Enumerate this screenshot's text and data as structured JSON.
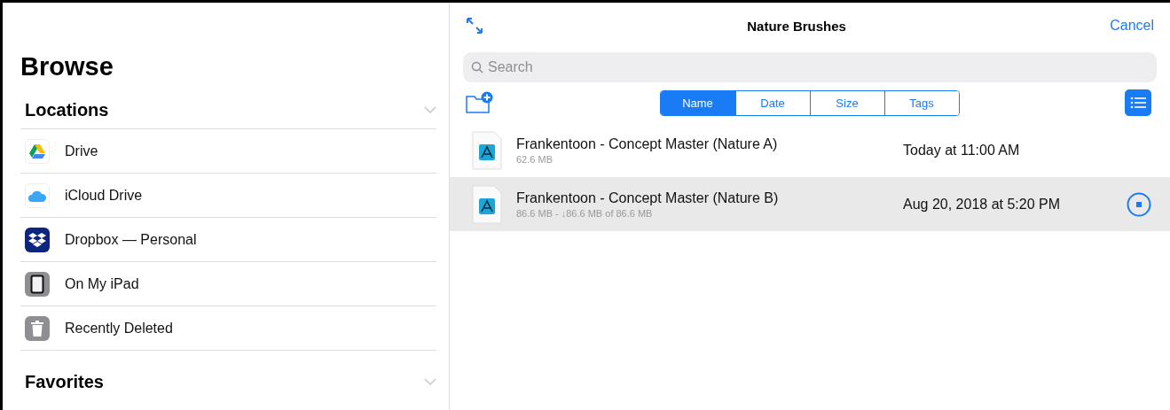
{
  "sidebar": {
    "title": "Browse",
    "sections": [
      {
        "title": "Locations",
        "items": [
          {
            "label": "Drive",
            "kind": "drive"
          },
          {
            "label": "iCloud Drive",
            "kind": "icloud"
          },
          {
            "label": "Dropbox — Personal",
            "kind": "dropbox"
          },
          {
            "label": "On My iPad",
            "kind": "ipad"
          },
          {
            "label": "Recently Deleted",
            "kind": "trash"
          }
        ]
      },
      {
        "title": "Favorites"
      }
    ]
  },
  "header": {
    "title": "Nature Brushes",
    "cancel": "Cancel"
  },
  "search": {
    "placeholder": "Search"
  },
  "sort_tabs": [
    {
      "label": "Name",
      "selected": true
    },
    {
      "label": "Date",
      "selected": false
    },
    {
      "label": "Size",
      "selected": false
    },
    {
      "label": "Tags",
      "selected": false
    }
  ],
  "files": [
    {
      "name": "Frankentoon - Concept Master (Nature A)",
      "detail": "62.6 MB",
      "date": "Today at 11:00 AM",
      "selected": false,
      "downloading": false
    },
    {
      "name": "Frankentoon - Concept Master (Nature B)",
      "detail": "86.6 MB - ↓86.6 MB of 86.6 MB",
      "date": "Aug 20, 2018 at 5:20 PM",
      "selected": true,
      "downloading": true
    }
  ]
}
